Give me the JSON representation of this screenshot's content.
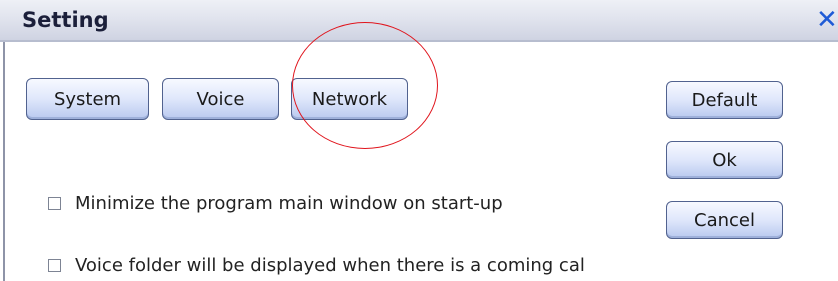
{
  "window": {
    "title": "Setting",
    "close_glyph": "✕"
  },
  "tabs": [
    {
      "label": "System"
    },
    {
      "label": "Voice"
    },
    {
      "label": "Network"
    }
  ],
  "actions": {
    "default_label": "Default",
    "ok_label": "Ok",
    "cancel_label": "Cancel"
  },
  "options": [
    {
      "label": "Minimize the program main window on start-up",
      "checked": false
    },
    {
      "label": "Voice folder will be displayed  when there is a coming cal",
      "checked": false
    }
  ],
  "annotation": {
    "highlight_target": "Network",
    "color": "#e0141c"
  }
}
